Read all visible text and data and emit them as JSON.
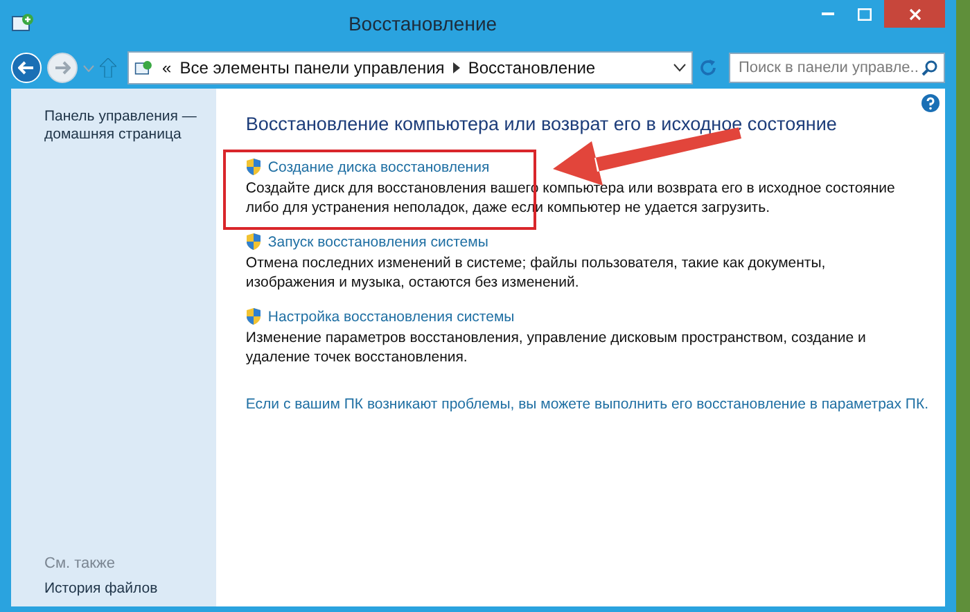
{
  "window": {
    "title": "Восстановление"
  },
  "address_bar": {
    "overflow": "«",
    "breadcrumbs": [
      "Все элементы панели управления",
      "Восстановление"
    ]
  },
  "search": {
    "placeholder": "Поиск в панели управле..."
  },
  "sidebar": {
    "home_link": "Панель управления — домашняя страница",
    "see_also": "См. также",
    "links": [
      "История файлов"
    ]
  },
  "main": {
    "heading": "Восстановление компьютера или возврат его в исходное состояние",
    "items": [
      {
        "title": "Создание диска восстановления",
        "description": "Создайте диск для восстановления вашего компьютера или возврата его в исходное состояние либо для устранения неполадок, даже если компьютер не удается загрузить.",
        "highlighted": true
      },
      {
        "title": "Запуск восстановления системы",
        "description": "Отмена последних изменений в системе; файлы пользователя, такие как документы, изображения и музыка, остаются без изменений.",
        "highlighted": false
      },
      {
        "title": "Настройка восстановления системы",
        "description": "Изменение параметров восстановления, управление дисковым пространством, создание и удаление точек восстановления.",
        "highlighted": false
      }
    ],
    "footer_link": "Если с вашим ПК возникают проблемы, вы можете выполнить его восстановление в параметрах ПК."
  }
}
